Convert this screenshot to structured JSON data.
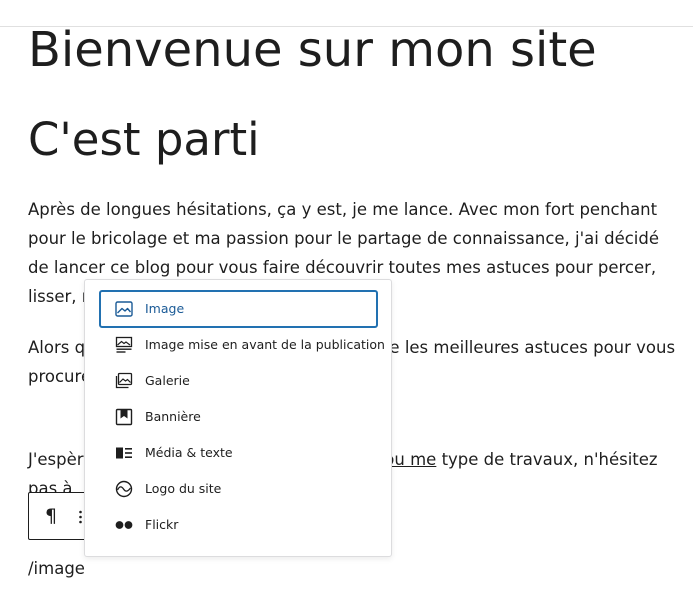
{
  "post": {
    "title": "Bienvenue sur mon site",
    "heading": "C'est parti",
    "paragraph1": "Après de longues hésitations, ça y est, je me lance. Avec mon fort penchant pour le bricolage et ma passion pour le partage de connaissance, j'ai décidé de lancer ce blog pour vous faire découvrir toutes mes astuces pour percer, lisser, masquer...",
    "paragraph2": "Alors que vous souhaitiez poser du carrelage les meilleures astuces pour vous procurer te est fait pour vous aider.",
    "paragraph3_start": "J'espère si vous souhaitez me faire coucou ",
    "paragraph3_link": "ou me",
    "paragraph3_end": " type de travaux, n'hésitez pas à",
    "slash_command": "/image"
  },
  "block_toolbar": {
    "block_type_symbol": "¶"
  },
  "inserter_menu": {
    "items": [
      {
        "label": "Image",
        "icon": "image-icon",
        "active": true
      },
      {
        "label": "Image mise en avant de la publication",
        "icon": "featured-image-icon",
        "active": false
      },
      {
        "label": "Galerie",
        "icon": "gallery-icon",
        "active": false
      },
      {
        "label": "Bannière",
        "icon": "cover-icon",
        "active": false
      },
      {
        "label": "Média & texte",
        "icon": "media-text-icon",
        "active": false
      },
      {
        "label": "Logo du site",
        "icon": "site-logo-icon",
        "active": false
      },
      {
        "label": "Flickr",
        "icon": "flickr-icon",
        "active": false
      }
    ]
  },
  "colors": {
    "accent": "#2271b1",
    "text": "#1e1e1e"
  }
}
